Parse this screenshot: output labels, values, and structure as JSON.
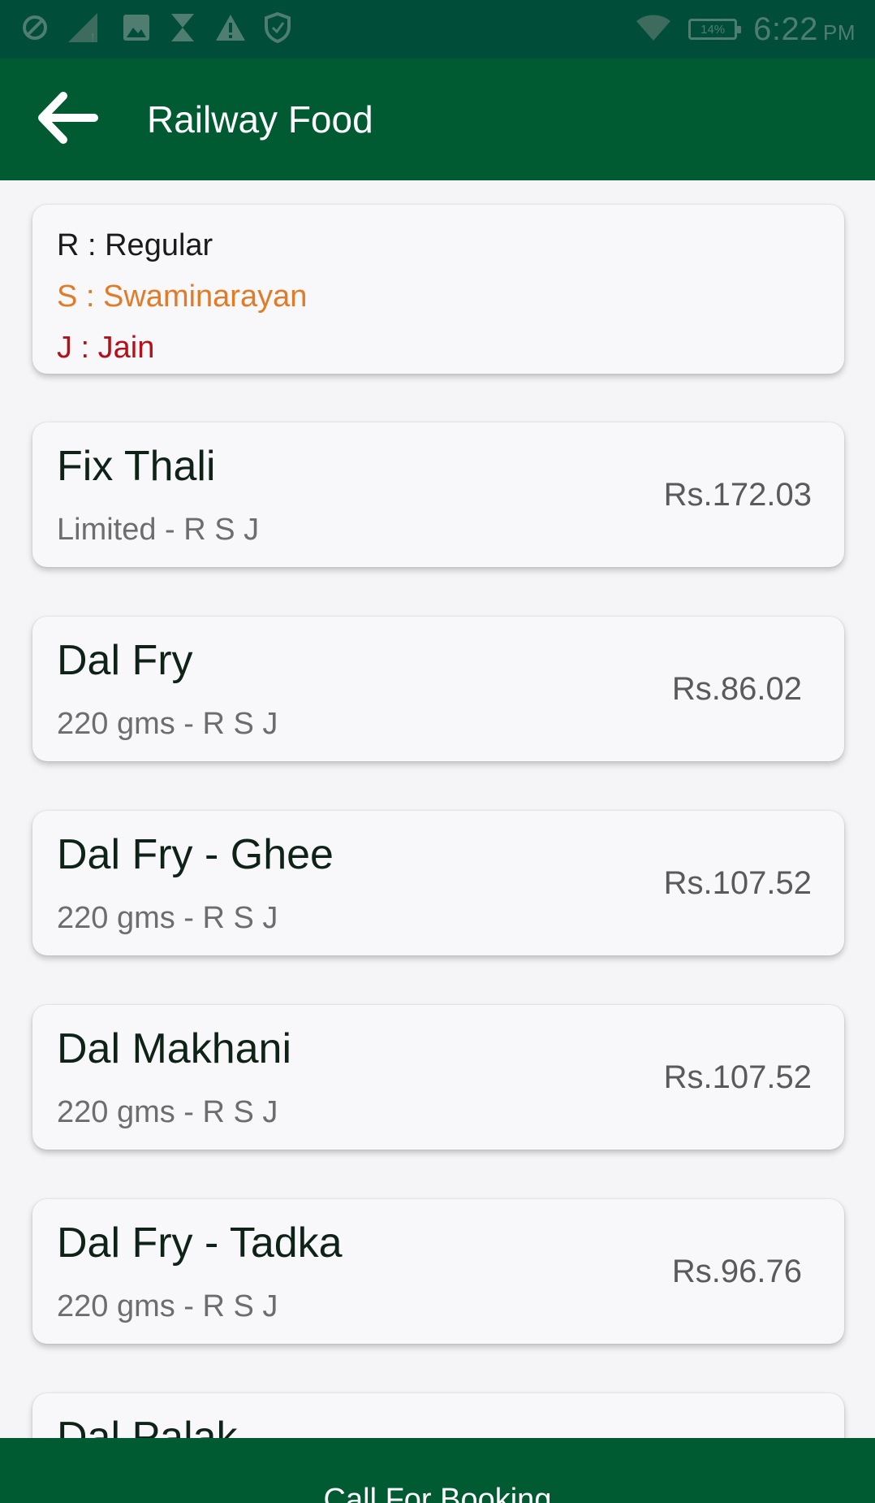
{
  "status_bar": {
    "time": "6:22",
    "ampm": "PM",
    "battery": "14%",
    "icons": [
      "do-not-disturb-icon",
      "signal-icon",
      "image-icon",
      "hourglass-icon",
      "warning-icon",
      "shield-icon",
      "wifi-icon",
      "battery-icon"
    ]
  },
  "app_bar": {
    "title": "Railway Food",
    "back_icon": "arrow-left-icon"
  },
  "legend": {
    "regular": "R : Regular",
    "swaminarayan": "S : Swaminarayan",
    "jain": "J : Jain",
    "colors": {
      "regular": "#1a1a1a",
      "swaminarayan": "#e07b28",
      "jain": "#b3101a"
    }
  },
  "items": [
    {
      "name": "Fix Thali",
      "detail": "Limited - R S J",
      "price": "Rs.172.03"
    },
    {
      "name": "Dal Fry",
      "detail": "220 gms - R S J",
      "price": "Rs.86.02"
    },
    {
      "name": "Dal Fry - Ghee",
      "detail": "220 gms - R S J",
      "price": "Rs.107.52"
    },
    {
      "name": "Dal Makhani",
      "detail": "220 gms - R S J",
      "price": "Rs.107.52"
    },
    {
      "name": "Dal Fry - Tadka",
      "detail": "220 gms - R S J",
      "price": "Rs.96.76"
    },
    {
      "name": "Dal Palak",
      "detail": "",
      "price": ""
    }
  ],
  "footer": {
    "call_label": "Call For Booking"
  },
  "colors": {
    "status_bar": "#004d3a",
    "app_bar": "#005b33",
    "background": "#f5f5f7"
  }
}
